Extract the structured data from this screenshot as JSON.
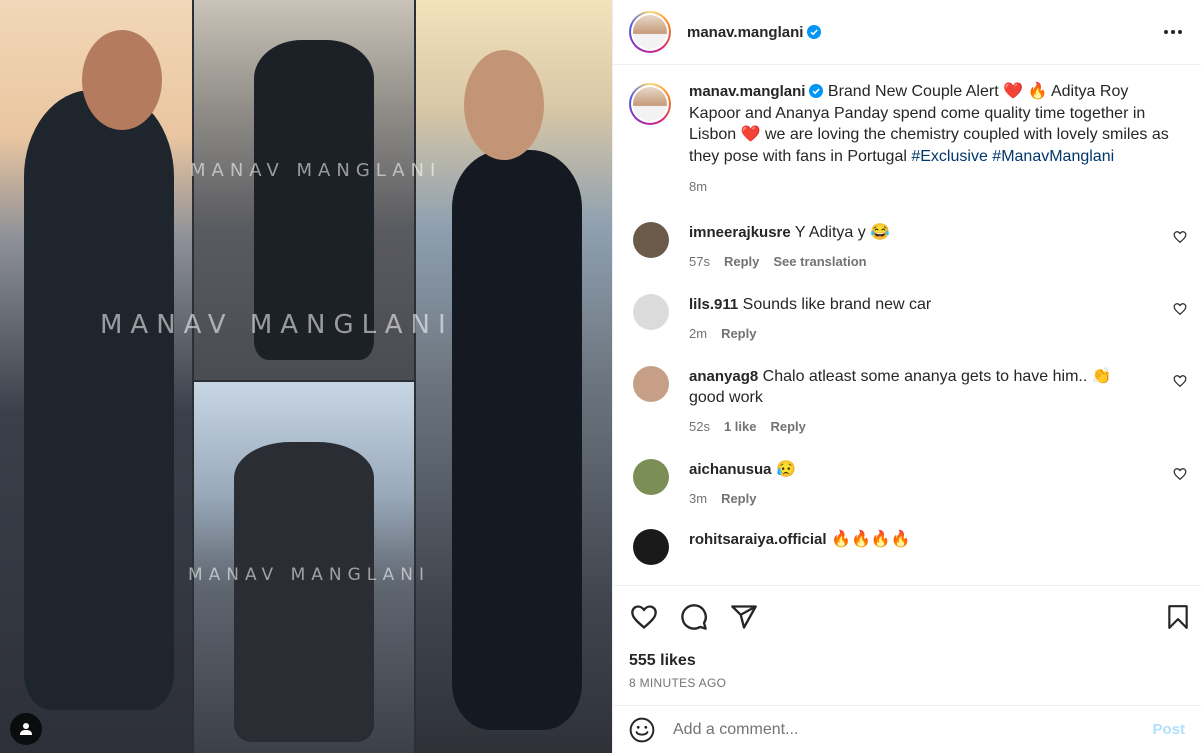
{
  "header": {
    "username": "manav.manglani",
    "verified": true,
    "more_icon": "more-horizontal-icon"
  },
  "media": {
    "watermark_text": "MANAV MANGLANI",
    "user_tag_icon": "user-tag-icon"
  },
  "caption": {
    "username": "manav.manglani",
    "text_part1": "Brand New Couple Alert",
    "emoji_heart1": "❤️",
    "emoji_fire": "🔥",
    "text_part2": "Aditya Roy Kapoor and Ananya Panday spend come quality time together in Lisbon",
    "emoji_heart2": "❤️",
    "text_part3": "we are loving the chemistry coupled with lovely smiles as they pose with fans in Portugal",
    "hashtag1": "#Exclusive",
    "hashtag2": "#ManavManglani",
    "time": "8m"
  },
  "comments": [
    {
      "username": "imneerajkusre",
      "text": "Y Aditya y 😂",
      "time": "57s",
      "likes": "",
      "reply": "Reply",
      "translate": "See translation",
      "avatar_color": "#6b5a4a"
    },
    {
      "username": "lils.911",
      "text": "Sounds like brand new car",
      "time": "2m",
      "likes": "",
      "reply": "Reply",
      "translate": "",
      "avatar_color": "#dbdbdb"
    },
    {
      "username": "ananyag8",
      "text": "Chalo atleast some ananya gets to have him.. 👏 good work",
      "time": "52s",
      "likes": "1 like",
      "reply": "Reply",
      "translate": "",
      "avatar_color": "#c79f86"
    },
    {
      "username": "aichanusua",
      "text": "😥",
      "time": "3m",
      "likes": "",
      "reply": "Reply",
      "translate": "",
      "avatar_color": "#7a8e55"
    },
    {
      "username": "rohitsaraiya.official",
      "text": "🔥🔥🔥🔥",
      "time": "",
      "likes": "",
      "reply": "",
      "translate": "",
      "avatar_color": "#1a1a1a"
    }
  ],
  "actions": {
    "like_icon": "heart-icon",
    "comment_icon": "comment-icon",
    "share_icon": "share-icon",
    "save_icon": "bookmark-icon",
    "likes_text": "555 likes",
    "posted_text": "8 MINUTES AGO"
  },
  "add_comment": {
    "placeholder": "Add a comment...",
    "post_label": "Post",
    "emoji_icon": "emoji-icon"
  },
  "colors": {
    "link": "#00376b",
    "verified": "#0095f6",
    "muted": "#737373",
    "post_disabled": "#b2dffc"
  }
}
